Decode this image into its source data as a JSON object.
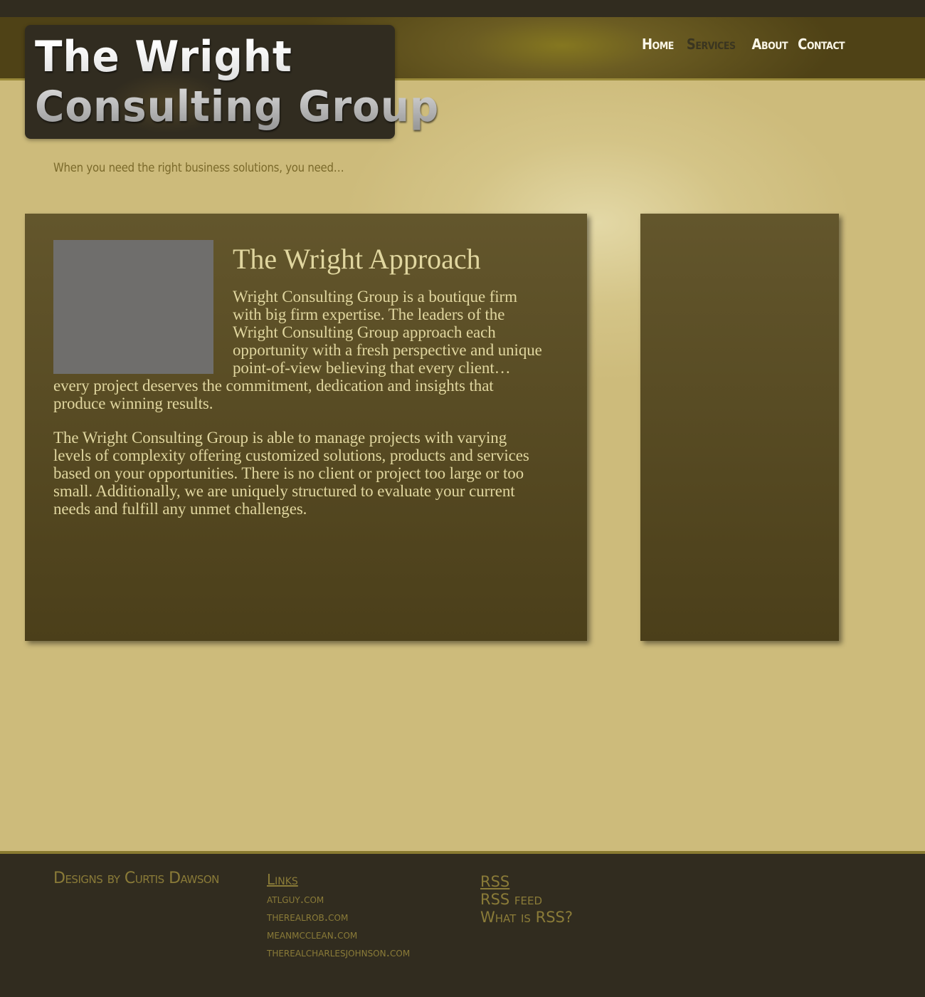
{
  "brand": {
    "logo_line1": "The Wright",
    "logo_line2": "Consulting Group",
    "tagline": "When you need the right business solutions, you need…"
  },
  "nav": {
    "items": [
      {
        "label": "Home",
        "active": false
      },
      {
        "label": "Services",
        "active": true
      },
      {
        "label": "About",
        "active": false
      },
      {
        "label": "Contact",
        "active": false
      }
    ]
  },
  "main": {
    "heading": "The Wright Approach",
    "paragraph1_lines": [
      "Wright Consulting Group is a boutique firm",
      "with big firm expertise.  The leaders of  the",
      "Wright Consulting Group approach each",
      "opportunity with a fresh perspective and unique",
      "point-of-view believing that every client…",
      "every project deserves the commitment, dedication and insights that",
      "produce winning results."
    ],
    "paragraph2_lines": [
      "The Wright Consulting Group is able to manage projects with varying",
      "levels of  complexity offering customized solutions, products and services",
      "based on your opportunities.  There is no client or project too large or too",
      "small.  Additionally, we are uniquely structured to evaluate your current",
      "needs and fulfill any unmet challenges."
    ]
  },
  "footer": {
    "credit": "Designs by Curtis Dawson",
    "links_heading": "Links",
    "links": [
      "atlguy.com",
      "therealrob.com",
      "meanmcclean.com",
      "therealcharlesjohnson.com"
    ],
    "rss_title": "RSS",
    "rss_feed": "RSS feed",
    "rss_help": "What is RSS?"
  },
  "colors": {
    "page_bg": "#cdbb7b",
    "header_band": "#6b5c22",
    "panel": "#5a4d25",
    "text_light": "#e0d69f",
    "footer_bg": "#312c1f",
    "footer_text": "#8a7b38"
  }
}
